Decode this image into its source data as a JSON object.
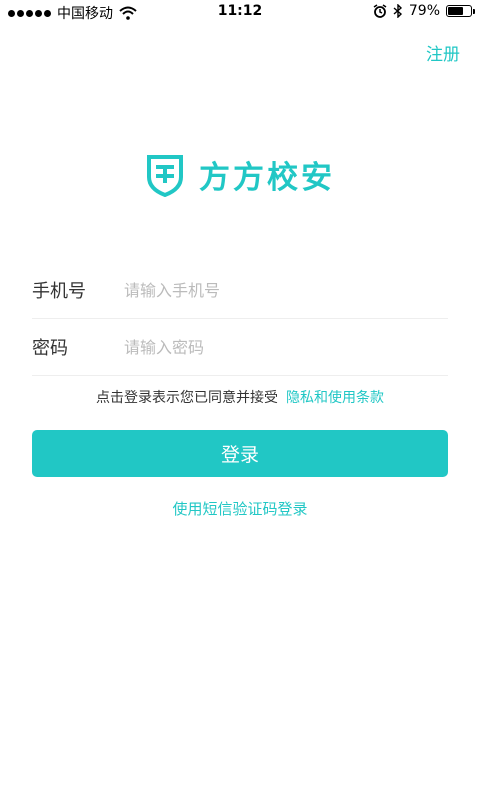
{
  "status_bar": {
    "carrier": "中国移动",
    "time": "11:12",
    "battery": "79%",
    "battery_level": 0.79,
    "icons": [
      "signal-icon",
      "wifi-icon",
      "alarm-icon",
      "bluetooth-icon",
      "battery-icon"
    ]
  },
  "header": {
    "register_label": "注册"
  },
  "logo": {
    "text": "方方校安",
    "icon": "shield-logo-icon"
  },
  "form": {
    "phone_label": "手机号",
    "phone_placeholder": "请输入手机号",
    "phone_value": "",
    "password_label": "密码",
    "password_placeholder": "请输入密码",
    "password_value": ""
  },
  "agreement": {
    "prefix": "点击登录表示您已同意并接受",
    "link": "隐私和使用条款"
  },
  "login_button": "登录",
  "sms_login": "使用短信验证码登录",
  "colors": {
    "accent": "#21c7c5",
    "divider": "#eeeeee",
    "placeholder": "#bbbbbb"
  }
}
